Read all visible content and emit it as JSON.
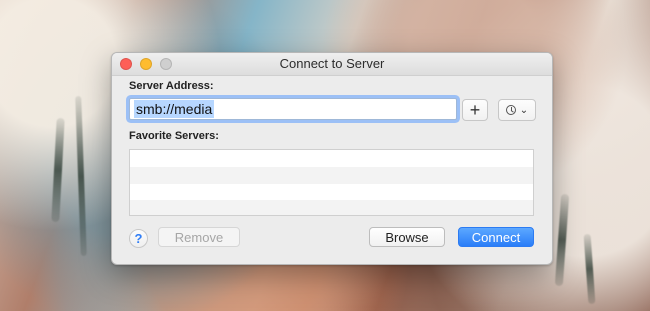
{
  "window": {
    "title": "Connect to Server"
  },
  "labels": {
    "server_address": "Server Address:",
    "favorite_servers": "Favorite Servers:"
  },
  "server_input": {
    "value": "smb://media"
  },
  "buttons": {
    "add": "+",
    "help": "?",
    "remove": "Remove",
    "browse": "Browse",
    "connect": "Connect",
    "recent_chevron": "⌄"
  },
  "favorites": [],
  "colors": {
    "accent": "#2a7df8",
    "selection": "#b7d7ff",
    "close": "#fe5f57",
    "minimize": "#febc2e"
  },
  "icons": {
    "recent": "clock-icon",
    "dropdown": "chevron-down-icon"
  }
}
